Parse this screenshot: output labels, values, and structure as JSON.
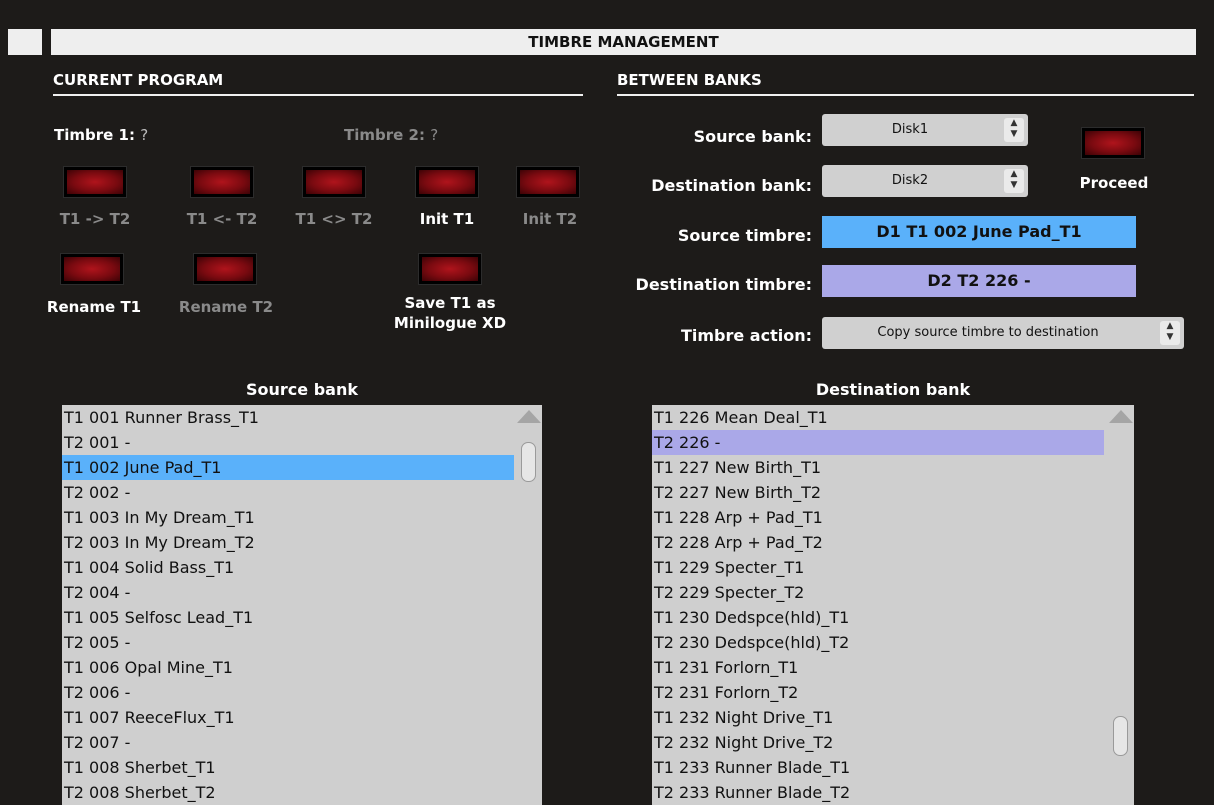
{
  "title": "TIMBRE MANAGEMENT",
  "current_program": {
    "heading": "CURRENT PROGRAM",
    "timbre1_label": "Timbre 1:",
    "timbre1_value": "?",
    "timbre2_label": "Timbre 2:",
    "timbre2_value": "?",
    "buttons": [
      {
        "label": "T1 -> T2",
        "enabled": false
      },
      {
        "label": "T1 <- T2",
        "enabled": false
      },
      {
        "label": "T1 <> T2",
        "enabled": false
      },
      {
        "label": "Init T1",
        "enabled": true
      },
      {
        "label": "Init T2",
        "enabled": false
      },
      {
        "label": "Rename T1",
        "enabled": true
      },
      {
        "label": "Rename T2",
        "enabled": false
      },
      {
        "label_line1": "Save T1 as",
        "label_line2": "Minilogue XD",
        "enabled": true
      }
    ]
  },
  "between_banks": {
    "heading": "BETWEEN BANKS",
    "source_bank_label": "Source bank:",
    "source_bank_value": "Disk1",
    "destination_bank_label": "Destination bank:",
    "destination_bank_value": "Disk2",
    "proceed_label": "Proceed",
    "source_timbre_label": "Source timbre:",
    "source_timbre_value": "D1 T1 002 June Pad_T1",
    "destination_timbre_label": "Destination timbre:",
    "destination_timbre_value": "D2 T2 226 -",
    "timbre_action_label": "Timbre action:",
    "timbre_action_value": "Copy source timbre to destination"
  },
  "colors": {
    "background": "#1d1b19",
    "source_highlight": "#5ab1fa",
    "destination_highlight": "#aaa8e8",
    "list_bg": "#cfcfcf"
  },
  "source_list": {
    "title": "Source bank",
    "selected_index": 2,
    "items": [
      "T1 001 Runner Brass_T1",
      "T2 001 -",
      "T1 002 June Pad_T1",
      "T2 002 -",
      "T1 003 In My Dream_T1",
      "T2 003 In My Dream_T2",
      "T1 004 Solid Bass_T1",
      "T2 004 -",
      "T1 005 Selfosc Lead_T1",
      "T2 005 -",
      "T1 006 Opal Mine_T1",
      "T2 006 -",
      "T1 007 ReeceFlux_T1",
      "T2 007 -",
      "T1 008 Sherbet_T1",
      "T2 008 Sherbet_T2"
    ]
  },
  "destination_list": {
    "title": "Destination bank",
    "selected_index": 1,
    "items": [
      "T1 226 Mean Deal_T1",
      "T2 226 -",
      "T1 227 New Birth_T1",
      "T2 227 New Birth_T2",
      "T1 228 Arp + Pad_T1",
      "T2 228 Arp + Pad_T2",
      "T1 229 Specter_T1",
      "T2 229 Specter_T2",
      "T1 230 Dedspce(hld)_T1",
      "T2 230 Dedspce(hld)_T2",
      "T1 231 Forlorn_T1",
      "T2 231 Forlorn_T2",
      "T1 232 Night Drive_T1",
      "T2 232 Night Drive_T2",
      "T1 233 Runner Blade_T1",
      "T2 233 Runner Blade_T2"
    ]
  }
}
